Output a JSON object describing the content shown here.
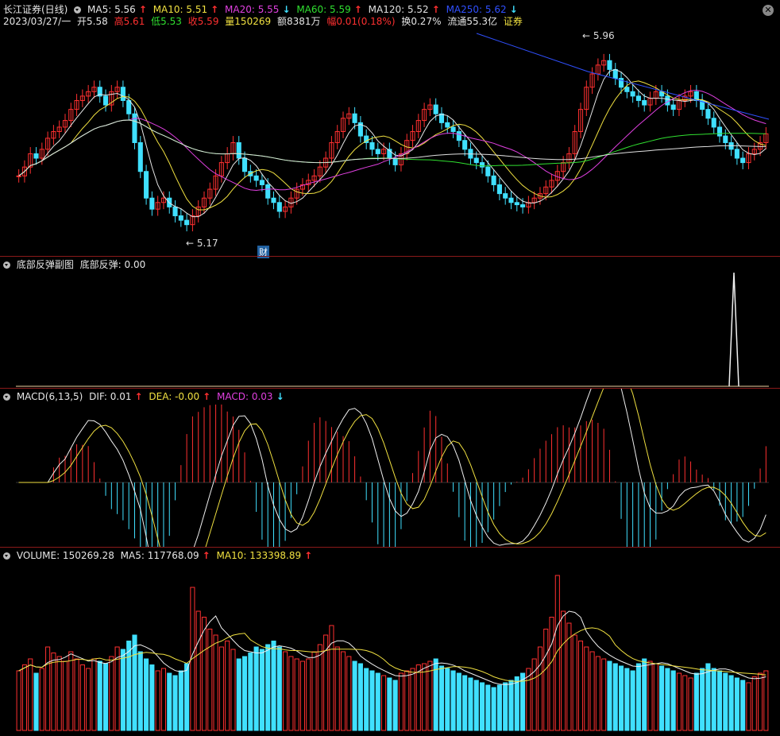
{
  "header": {
    "title": "长江证券(日线)",
    "ma5": "MA5: 5.56",
    "ma10": "MA10: 5.51",
    "ma20": "MA20: 5.55",
    "ma60": "MA60: 5.59",
    "ma120": "MA120: 5.52",
    "ma250": "MA250: 5.62",
    "date": "2023/03/27/一",
    "open": "开5.58",
    "high": "高5.61",
    "low": "低5.53",
    "close": "收5.59",
    "vol": "量150269",
    "amount": "额8381万",
    "chg": "幅0.01(0.18%)",
    "turnover": "换0.27%",
    "float": "流通55.3亿",
    "sector": "证券"
  },
  "annotations": {
    "high_label": "5.96",
    "low_label": "5.17",
    "finance_label": "财"
  },
  "indicator": {
    "title": "底部反弹副图",
    "value": "底部反弹: 0.00"
  },
  "macd": {
    "title": "MACD(6,13,5)",
    "dif": "DIF: 0.01",
    "dea": "DEA: -0.00",
    "macd": "MACD: 0.03"
  },
  "volume": {
    "title": "VOLUME: 150269.28",
    "ma5": "MA5: 117768.09",
    "ma10": "MA10: 133398.89"
  },
  "colors": {
    "up": "#ff3030",
    "down": "#40e0ff",
    "ma5": "#e6e6e6",
    "ma10": "#f0e040",
    "ma20": "#e040e0",
    "ma60": "#30e030",
    "ma120": "#e0e0e0",
    "ma250": "#3050ff"
  },
  "chart_data": {
    "type": "candlestick",
    "price_range": [
      5.1,
      6.05
    ],
    "close": [
      5.4,
      5.44,
      5.5,
      5.48,
      5.52,
      5.57,
      5.6,
      5.62,
      5.65,
      5.7,
      5.74,
      5.76,
      5.78,
      5.8,
      5.76,
      5.72,
      5.78,
      5.8,
      5.74,
      5.68,
      5.55,
      5.42,
      5.3,
      5.25,
      5.28,
      5.3,
      5.26,
      5.22,
      5.2,
      5.18,
      5.22,
      5.26,
      5.3,
      5.34,
      5.4,
      5.46,
      5.5,
      5.55,
      5.48,
      5.42,
      5.4,
      5.38,
      5.36,
      5.3,
      5.28,
      5.24,
      5.26,
      5.3,
      5.34,
      5.36,
      5.38,
      5.4,
      5.44,
      5.48,
      5.55,
      5.6,
      5.66,
      5.68,
      5.64,
      5.58,
      5.55,
      5.52,
      5.5,
      5.52,
      5.48,
      5.45,
      5.5,
      5.56,
      5.6,
      5.65,
      5.7,
      5.72,
      5.68,
      5.64,
      5.62,
      5.6,
      5.56,
      5.52,
      5.48,
      5.46,
      5.44,
      5.4,
      5.36,
      5.32,
      5.3,
      5.28,
      5.27,
      5.26,
      5.28,
      5.3,
      5.32,
      5.35,
      5.38,
      5.42,
      5.46,
      5.5,
      5.6,
      5.7,
      5.8,
      5.86,
      5.9,
      5.92,
      5.88,
      5.84,
      5.8,
      5.78,
      5.76,
      5.74,
      5.72,
      5.75,
      5.78,
      5.76,
      5.72,
      5.7,
      5.74,
      5.76,
      5.78,
      5.74,
      5.7,
      5.66,
      5.62,
      5.58,
      5.55,
      5.52,
      5.48,
      5.46,
      5.5,
      5.52,
      5.55,
      5.59
    ],
    "volume": [
      50,
      55,
      60,
      48,
      52,
      70,
      65,
      62,
      58,
      66,
      60,
      55,
      52,
      60,
      58,
      56,
      62,
      70,
      68,
      75,
      80,
      66,
      60,
      55,
      50,
      52,
      48,
      46,
      50,
      56,
      120,
      100,
      95,
      85,
      80,
      70,
      75,
      68,
      60,
      62,
      65,
      70,
      68,
      72,
      75,
      70,
      66,
      62,
      60,
      58,
      60,
      66,
      72,
      80,
      88,
      70,
      66,
      62,
      58,
      56,
      52,
      50,
      48,
      46,
      44,
      42,
      48,
      50,
      52,
      55,
      56,
      58,
      60,
      54,
      52,
      50,
      48,
      46,
      44,
      42,
      40,
      38,
      36,
      38,
      40,
      42,
      45,
      48,
      52,
      60,
      70,
      85,
      95,
      130,
      100,
      90,
      80,
      75,
      70,
      66,
      62,
      60,
      58,
      56,
      54,
      52,
      50,
      56,
      60,
      58,
      56,
      54,
      52,
      50,
      48,
      46,
      44,
      48,
      52,
      56,
      52,
      50,
      48,
      46,
      44,
      42,
      40,
      45,
      48,
      50
    ]
  }
}
